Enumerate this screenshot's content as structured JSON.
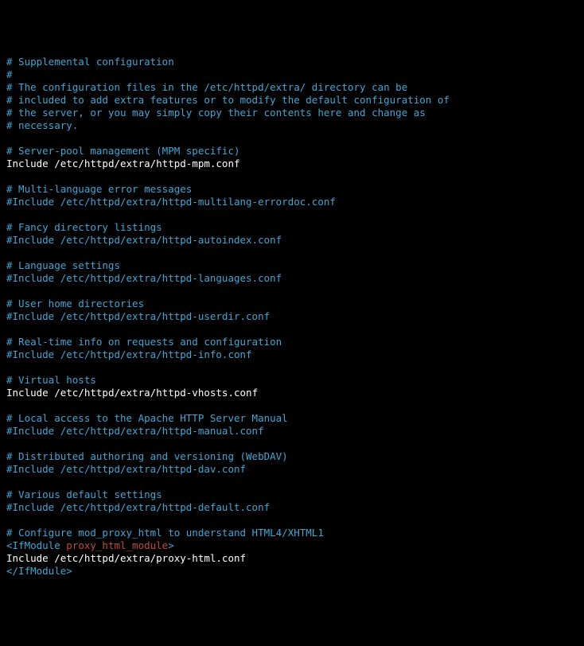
{
  "lines": [
    [
      {
        "cls": "c",
        "text": "# Supplemental configuration"
      }
    ],
    [
      {
        "cls": "c",
        "text": "#"
      }
    ],
    [
      {
        "cls": "c",
        "text": "# The configuration files in the /etc/httpd/extra/ directory can be"
      }
    ],
    [
      {
        "cls": "c",
        "text": "# included to add extra features or to modify the default configuration of"
      }
    ],
    [
      {
        "cls": "c",
        "text": "# the server, or you may simply copy their contents here and change as"
      }
    ],
    [
      {
        "cls": "c",
        "text": "# necessary."
      }
    ],
    [],
    [
      {
        "cls": "c",
        "text": "# Server-pool management (MPM specific)"
      }
    ],
    [
      {
        "cls": "kw",
        "text": "Include "
      },
      {
        "cls": "path",
        "text": "/etc/httpd/extra/httpd-mpm.conf"
      }
    ],
    [],
    [
      {
        "cls": "c",
        "text": "# Multi-language error messages"
      }
    ],
    [
      {
        "cls": "c",
        "text": "#Include /etc/httpd/extra/httpd-multilang-errordoc.conf"
      }
    ],
    [],
    [
      {
        "cls": "c",
        "text": "# Fancy directory listings"
      }
    ],
    [
      {
        "cls": "c",
        "text": "#Include /etc/httpd/extra/httpd-autoindex.conf"
      }
    ],
    [],
    [
      {
        "cls": "c",
        "text": "# Language settings"
      }
    ],
    [
      {
        "cls": "c",
        "text": "#Include /etc/httpd/extra/httpd-languages.conf"
      }
    ],
    [],
    [
      {
        "cls": "c",
        "text": "# User home directories"
      }
    ],
    [
      {
        "cls": "c",
        "text": "#Include /etc/httpd/extra/httpd-userdir.conf"
      }
    ],
    [],
    [
      {
        "cls": "c",
        "text": "# Real-time info on requests and configuration"
      }
    ],
    [
      {
        "cls": "c",
        "text": "#Include /etc/httpd/extra/httpd-info.conf"
      }
    ],
    [],
    [
      {
        "cls": "c",
        "text": "# Virtual hosts"
      }
    ],
    [
      {
        "cls": "kw",
        "text": "Include "
      },
      {
        "cls": "path",
        "text": "/etc/httpd/extra/httpd-vhosts.conf"
      }
    ],
    [],
    [
      {
        "cls": "c",
        "text": "# Local access to the Apache HTTP Server Manual"
      }
    ],
    [
      {
        "cls": "c",
        "text": "#Include /etc/httpd/extra/httpd-manual.conf"
      }
    ],
    [],
    [
      {
        "cls": "c",
        "text": "# Distributed authoring and versioning (WebDAV)"
      }
    ],
    [
      {
        "cls": "c",
        "text": "#Include /etc/httpd/extra/httpd-dav.conf"
      }
    ],
    [],
    [
      {
        "cls": "c",
        "text": "# Various default settings"
      }
    ],
    [
      {
        "cls": "c",
        "text": "#Include /etc/httpd/extra/httpd-default.conf"
      }
    ],
    [],
    [
      {
        "cls": "c",
        "text": "# Configure mod_proxy_html to understand HTML4/XHTML1"
      }
    ],
    [
      {
        "cls": "tag",
        "text": "<IfModule "
      },
      {
        "cls": "mod",
        "text": "proxy_html_module"
      },
      {
        "cls": "tag",
        "text": ">"
      }
    ],
    [
      {
        "cls": "kw",
        "text": "Include "
      },
      {
        "cls": "path",
        "text": "/etc/httpd/extra/proxy-html.conf"
      }
    ],
    [
      {
        "cls": "tag",
        "text": "</IfModule>"
      }
    ]
  ]
}
